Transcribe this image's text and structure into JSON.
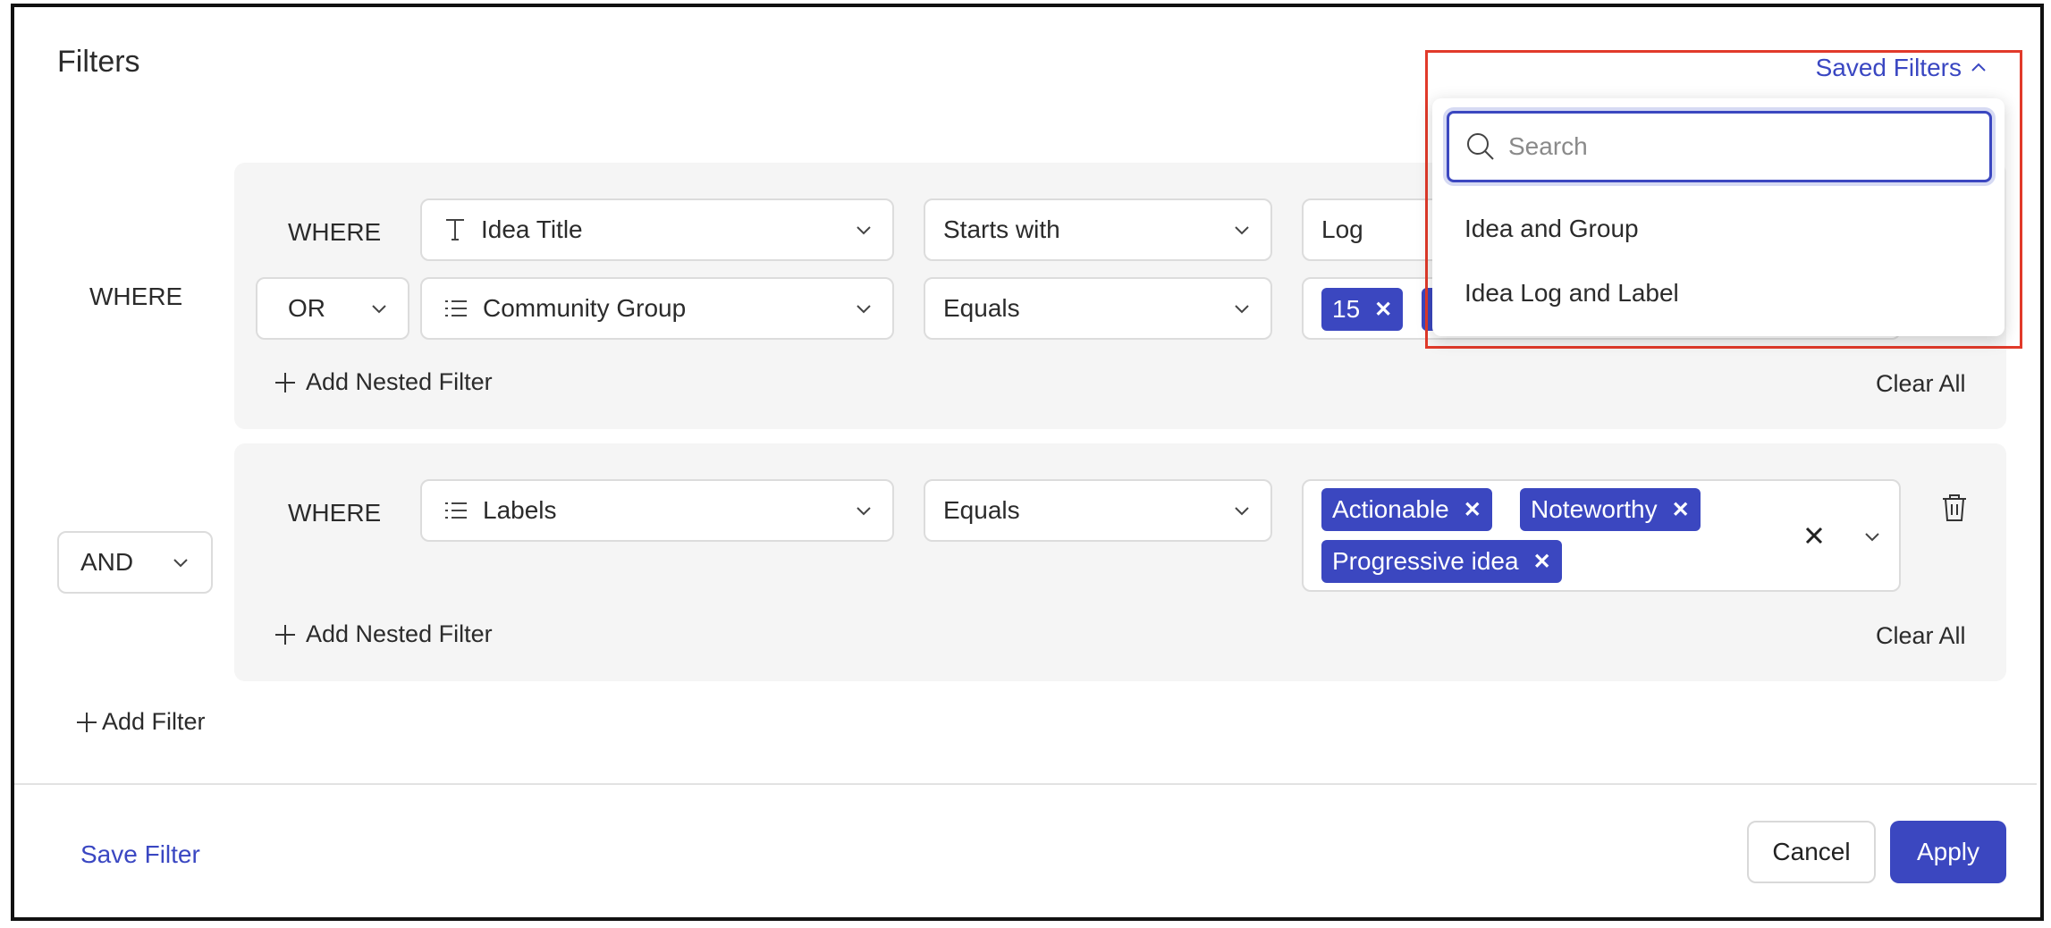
{
  "title": "Filters",
  "saved_filters": {
    "label": "Saved Filters",
    "search_placeholder": "Search",
    "items": [
      "Idea and Group",
      "Idea Log and Label"
    ]
  },
  "outer_where": "WHERE",
  "group1": {
    "row1": {
      "prefix": "WHERE",
      "field": "Idea Title",
      "operator": "Starts with",
      "value": "Log"
    },
    "row2": {
      "conjunction": "OR",
      "field": "Community Group",
      "operator": "Equals",
      "tags": [
        "15"
      ]
    },
    "add_nested": "Add Nested Filter",
    "clear_all": "Clear All"
  },
  "group2_conjunction": "AND",
  "group2": {
    "row1": {
      "prefix": "WHERE",
      "field": "Labels",
      "operator": "Equals",
      "tags": [
        "Actionable",
        "Noteworthy",
        "Progressive idea"
      ]
    },
    "add_nested": "Add Nested Filter",
    "clear_all": "Clear All"
  },
  "add_filter": "Add Filter",
  "footer": {
    "save_filter": "Save Filter",
    "cancel": "Cancel",
    "apply": "Apply"
  },
  "colors": {
    "accent": "#3b47c0",
    "highlight": "#e13a2a"
  }
}
